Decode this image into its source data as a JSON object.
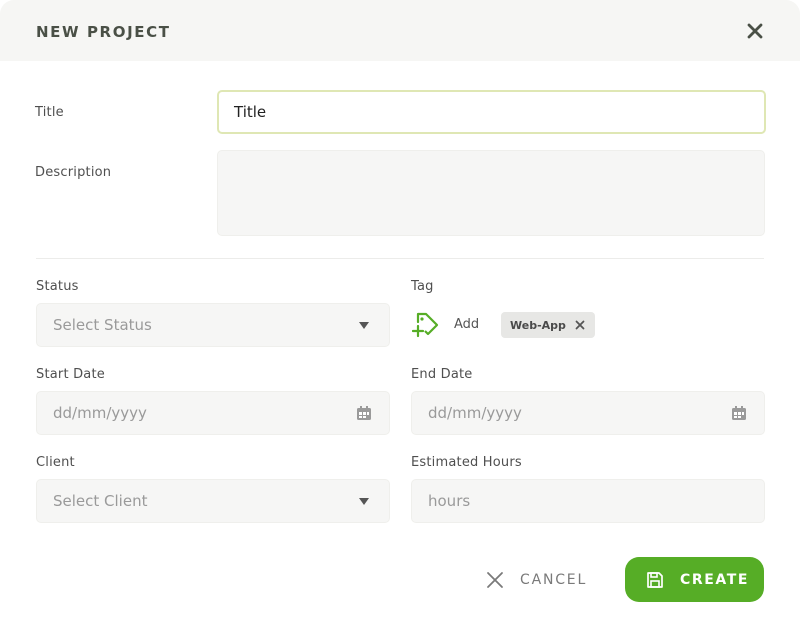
{
  "dialog": {
    "title": "NEW PROJECT",
    "close_icon": "close-icon"
  },
  "fields": {
    "title": {
      "label": "Title",
      "value": "Title"
    },
    "description": {
      "label": "Description",
      "value": ""
    },
    "status": {
      "label": "Status",
      "placeholder": "Select Status"
    },
    "tag": {
      "label": "Tag",
      "add_label": "Add",
      "add_icon": "tag-add-icon",
      "chips": [
        {
          "label": "Web-App"
        }
      ]
    },
    "start_date": {
      "label": "Start Date",
      "placeholder": "dd/mm/yyyy"
    },
    "end_date": {
      "label": "End Date",
      "placeholder": "dd/mm/yyyy"
    },
    "client": {
      "label": "Client",
      "placeholder": "Select Client"
    },
    "estimated_hours": {
      "label": "Estimated Hours",
      "placeholder": "hours"
    }
  },
  "actions": {
    "cancel_label": "CANCEL",
    "create_label": "CREATE"
  },
  "colors": {
    "accent": "#56ad26",
    "header_bg": "#f6f6f4",
    "input_bg": "#f6f6f5",
    "focus_border": "#dfe7b4",
    "chip_bg": "#e7e7e5"
  }
}
